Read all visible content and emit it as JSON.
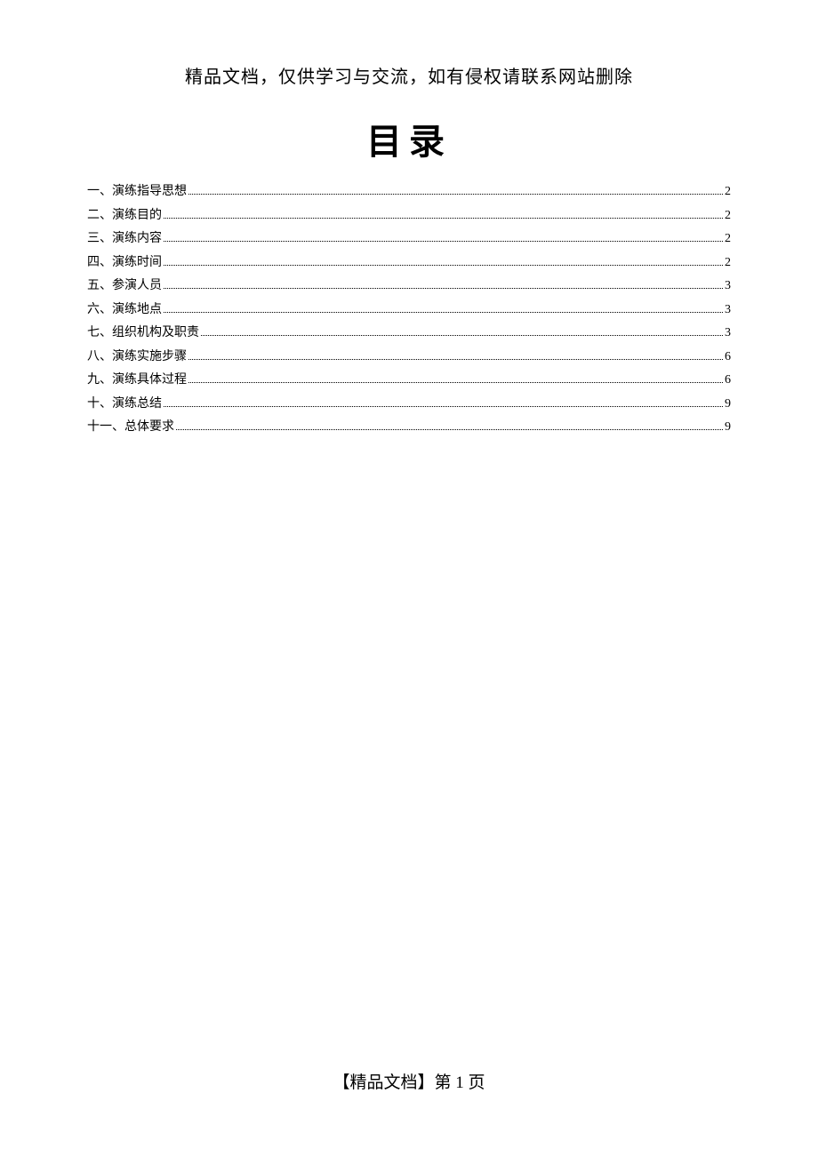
{
  "header": {
    "notice": "精品文档，仅供学习与交流，如有侵权请联系网站删除"
  },
  "title": "目录",
  "toc": {
    "entries": [
      {
        "label": "一、演练指导思想",
        "page": "2"
      },
      {
        "label": "二、演练目的",
        "page": "2"
      },
      {
        "label": "三、演练内容",
        "page": "2"
      },
      {
        "label": "四、演练时间",
        "page": "2"
      },
      {
        "label": "五、参演人员",
        "page": "3"
      },
      {
        "label": "六、演练地点",
        "page": "3"
      },
      {
        "label": "七、组织机构及职责",
        "page": "3"
      },
      {
        "label": "八、演练实施步骤",
        "page": "6"
      },
      {
        "label": "九、演练具体过程",
        "page": "6"
      },
      {
        "label": "十、演练总结",
        "page": "9"
      },
      {
        "label": "十一、总体要求",
        "page": "9"
      }
    ]
  },
  "footer": {
    "text": "【精品文档】第 1 页"
  }
}
